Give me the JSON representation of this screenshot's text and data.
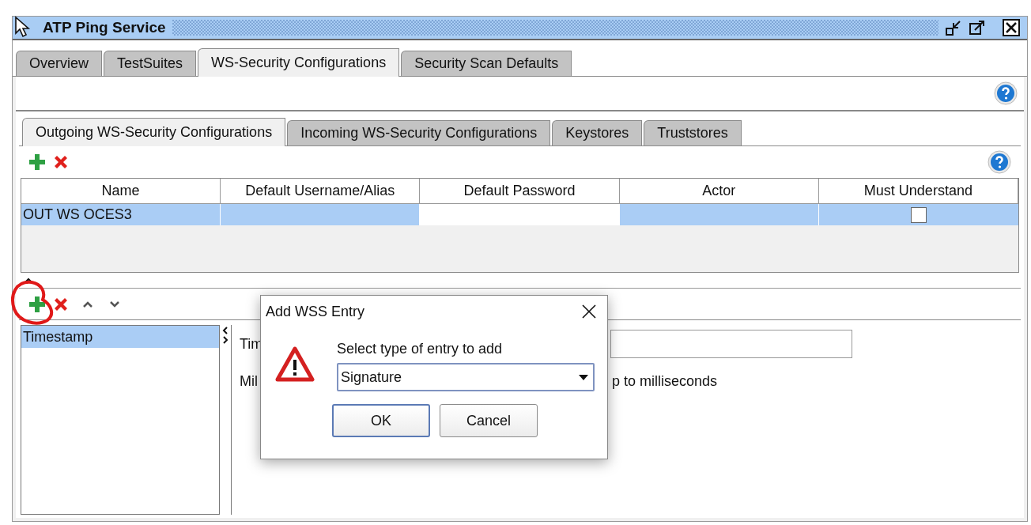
{
  "window": {
    "title": "ATP Ping Service"
  },
  "tabs": [
    {
      "label": "Overview",
      "selected": false
    },
    {
      "label": "TestSuites",
      "selected": false
    },
    {
      "label": "WS-Security Configurations",
      "selected": true
    },
    {
      "label": "Security Scan Defaults",
      "selected": false
    }
  ],
  "inner_tabs": [
    {
      "label": "Outgoing WS-Security Configurations",
      "selected": true
    },
    {
      "label": "Incoming WS-Security Configurations",
      "selected": false
    },
    {
      "label": "Keystores",
      "selected": false
    },
    {
      "label": "Truststores",
      "selected": false
    }
  ],
  "table": {
    "columns": [
      "Name",
      "Default Username/Alias",
      "Default Password",
      "Actor",
      "Must Understand"
    ],
    "rows": [
      {
        "selected": true,
        "cells": [
          {
            "kind": "text",
            "text": "OUT WS OCES3",
            "selected": true
          },
          {
            "kind": "empty",
            "selected": true
          },
          {
            "kind": "empty",
            "selected": false
          },
          {
            "kind": "empty",
            "selected": true
          },
          {
            "kind": "checkbox",
            "checked": false,
            "selected": true
          }
        ]
      }
    ]
  },
  "entries": [
    {
      "label": "Timestamp",
      "selected": true
    }
  ],
  "detail": {
    "row_1_label": "Tim",
    "row_2_label": "Mil",
    "row_2_text": "p to milliseconds"
  },
  "dialog": {
    "title": "Add WSS Entry",
    "prompt": "Select type of entry to add",
    "select_value": "Signature",
    "buttons": [
      {
        "label": "OK",
        "default": true
      },
      {
        "label": "Cancel",
        "default": false
      }
    ]
  }
}
